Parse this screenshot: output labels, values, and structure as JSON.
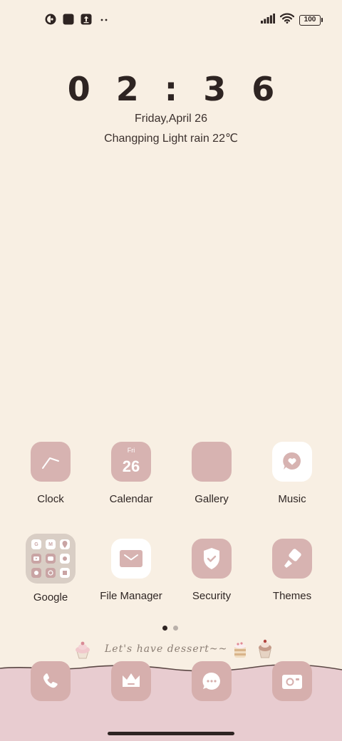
{
  "status_bar": {
    "left_icons": [
      "app-notification-icon",
      "square-notification-icon",
      "upload-icon",
      "more-dots-icon"
    ],
    "right_icons": [
      "signal-icon",
      "wifi-icon",
      "battery-icon"
    ],
    "battery_level": "100"
  },
  "clock_widget": {
    "time": "0 2 : 3 6",
    "date": "Friday,April 26",
    "weather": "Changping Light rain 22℃"
  },
  "apps_row1": [
    {
      "label": "Clock",
      "icon": "clock-icon"
    },
    {
      "label": "Calendar",
      "icon": "calendar-icon",
      "day": "Fri",
      "date": "26"
    },
    {
      "label": "Gallery",
      "icon": "moon-icon"
    },
    {
      "label": "Music",
      "icon": "heart-chat-icon"
    }
  ],
  "apps_row2": [
    {
      "label": "Google",
      "icon": "folder-icon",
      "mini": [
        "G",
        "M",
        "",
        "",
        "",
        "",
        "",
        "",
        ""
      ]
    },
    {
      "label": "File Manager",
      "icon": "envelope-icon"
    },
    {
      "label": "Security",
      "icon": "shield-check-icon"
    },
    {
      "label": "Themes",
      "icon": "brush-icon"
    }
  ],
  "page_indicator": {
    "pages": 2,
    "active": 1
  },
  "dessert_widget": {
    "text": "Let's have dessert~~"
  },
  "dock": [
    "phone-icon",
    "crown-icon",
    "chat-bubble-icon",
    "camera-icon"
  ],
  "colors": {
    "background": "#f8efe3",
    "icon_pink": "#d7b3b1",
    "dock_bg": "#e8ccd0",
    "text": "#2e2422"
  }
}
